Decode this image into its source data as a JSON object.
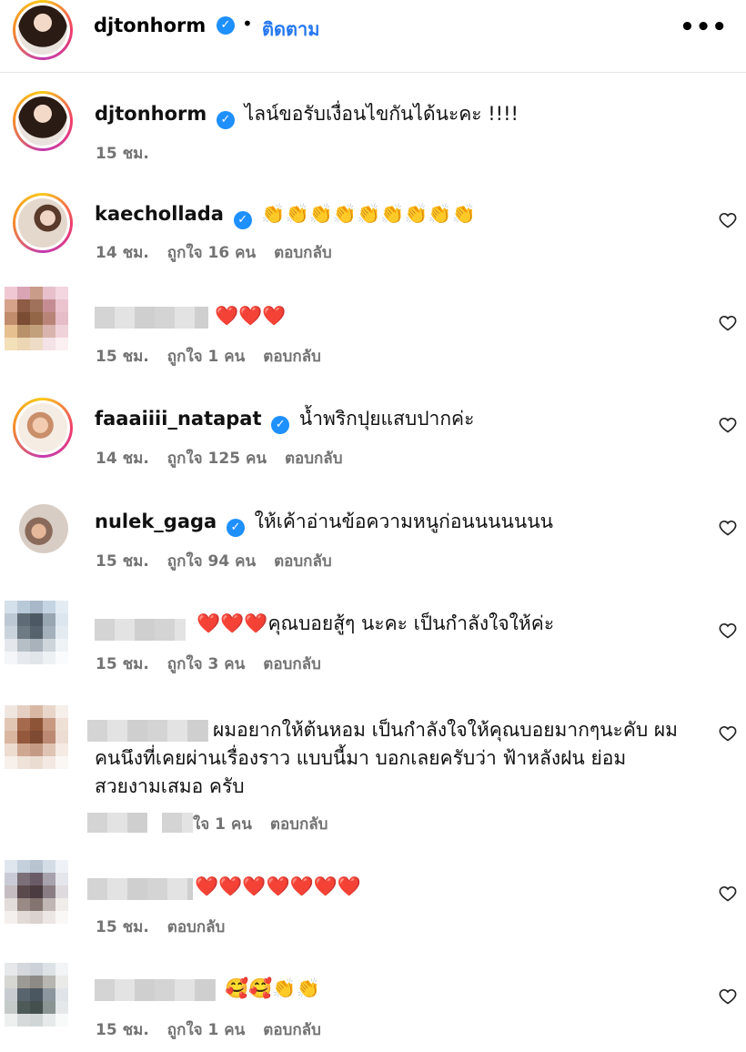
{
  "post": {
    "author": "djtonhorm",
    "follow_label": "ติดตาม",
    "more_label": "•••"
  },
  "caption": {
    "author": "djtonhorm",
    "text": "ไลน์ขอรับเงื่อนไขกันได้นะคะ !!!!",
    "time": "15 ชม."
  },
  "comments": [
    {
      "author": "kaechollada",
      "verified": true,
      "text": "👏👏👏👏👏👏👏👏👏",
      "time": "14 ชม.",
      "likes": "ถูกใจ 16 คน",
      "reply": "ตอบกลับ"
    },
    {
      "author": "",
      "verified": false,
      "text": "❤️❤️❤️",
      "time": "15 ชม.",
      "likes": "ถูกใจ 1 คน",
      "reply": "ตอบกลับ"
    },
    {
      "author": "faaaiiii_natapat",
      "verified": true,
      "text": "น้ำพริกปุยแสบปากค่ะ",
      "time": "14 ชม.",
      "likes": "ถูกใจ 125 คน",
      "reply": "ตอบกลับ"
    },
    {
      "author": "nulek_gaga",
      "verified": true,
      "text": "ให้เค้าอ่านข้อความหนูก่อนนนนนนน",
      "time": "15 ชม.",
      "likes": "ถูกใจ 94 คน",
      "reply": "ตอบกลับ"
    },
    {
      "author": "",
      "verified": false,
      "text": "❤️❤️❤️คุณบอยสู้ๆ นะคะ เป็นกำลังใจให้ค่ะ",
      "time": "15 ชม.",
      "likes": "ถูกใจ 3 คน",
      "reply": "ตอบกลับ"
    },
    {
      "author": "",
      "verified": false,
      "text": "ผมอยากให้ต้นหอม เป็นกำลังใจให้คุณบอยมากๆนะคับ ผมคนนึงที่เคยผ่านเรื่องราว แบบนี้มา บอกเลยครับว่า ฟ้าหลังฝน ย่อม สวยงามเสมอ ครับ",
      "time": "",
      "likes": "ใจ 1 คน",
      "reply": "ตอบกลับ"
    },
    {
      "author": "",
      "verified": false,
      "text": "❤️❤️❤️❤️❤️❤️❤️",
      "time": "15 ชม.",
      "likes": "",
      "reply": "ตอบกลับ"
    },
    {
      "author": "",
      "verified": false,
      "text": "🥰🥰👏👏",
      "time": "15 ชม.",
      "likes": "ถูกใจ 1 คน",
      "reply": "ตอบกลับ"
    }
  ],
  "colors": {
    "accent": "#2678f1",
    "verified": "#1e90ff",
    "meta": "#737373",
    "heart": "#e0245e"
  },
  "icons": {
    "verified": "verified-badge-icon",
    "like": "heart-outline-icon",
    "more": "more-options-icon"
  }
}
